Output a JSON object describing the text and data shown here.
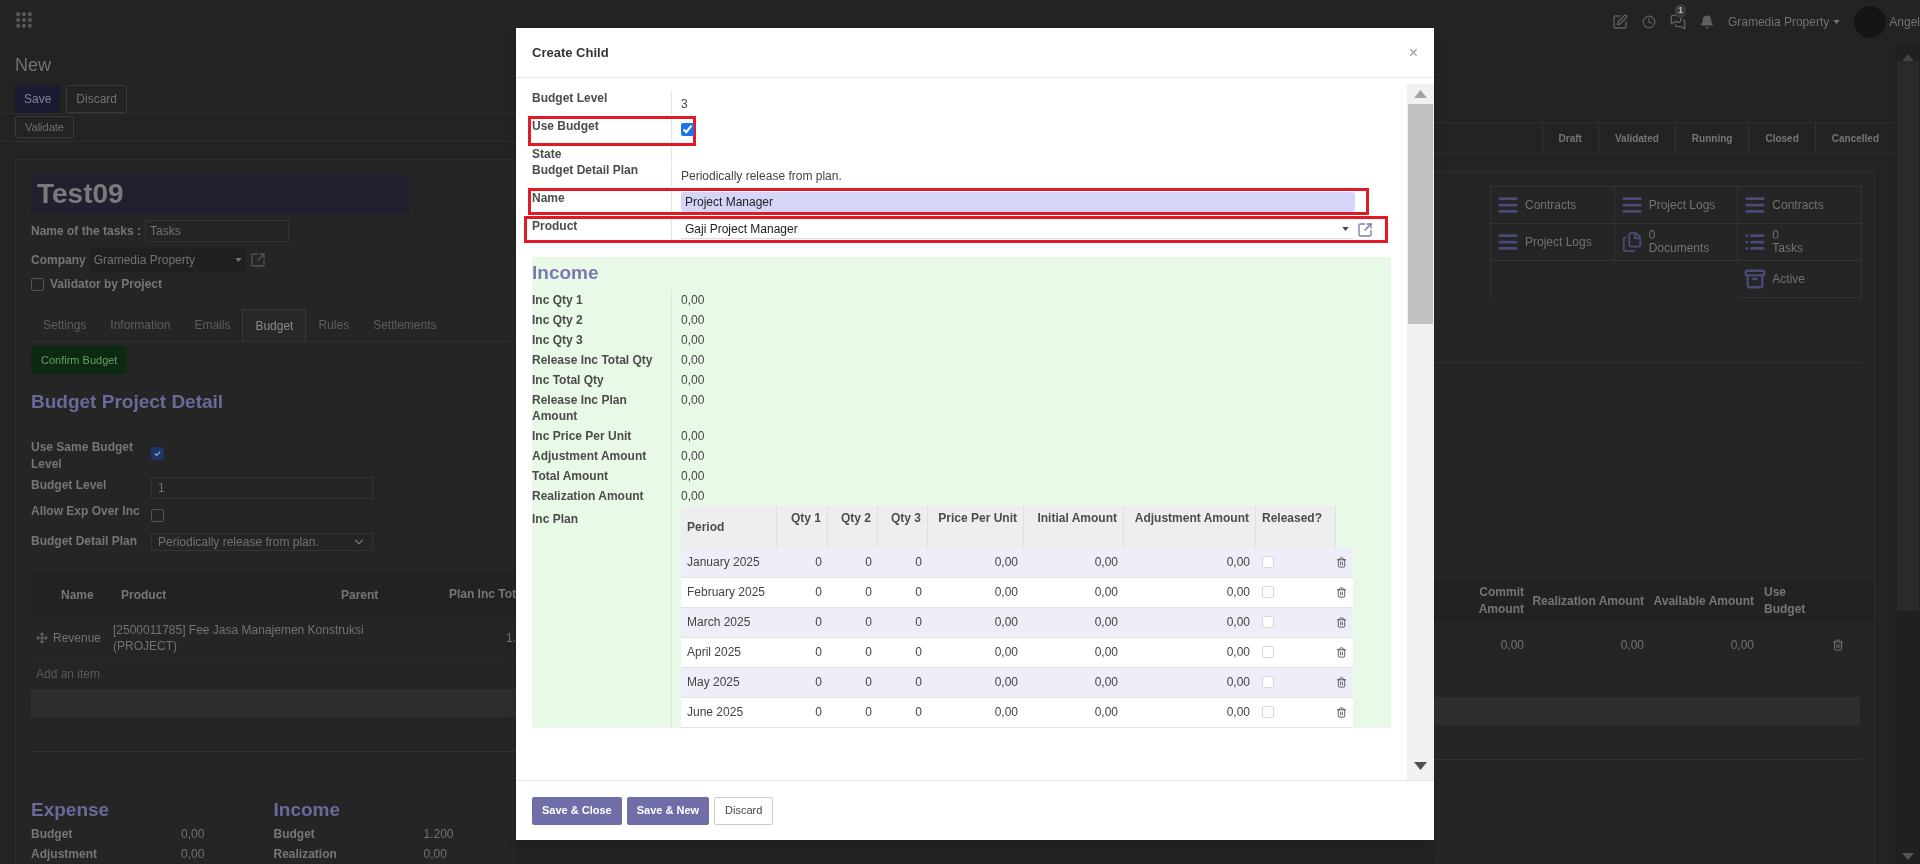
{
  "topbar": {
    "chat_badge": "1",
    "company": "Gramedia Property",
    "user": "Angel"
  },
  "breadcrumb": "New",
  "actions": [
    {
      "label": "Save",
      "kind": "primary"
    },
    {
      "label": "Discard",
      "kind": "secondary"
    }
  ],
  "status_action": "Validate",
  "stages": [
    {
      "label": "Draft",
      "selected": false
    },
    {
      "label": "Validated",
      "selected": false
    },
    {
      "label": "Running",
      "selected": false
    },
    {
      "label": "Closed",
      "selected": false
    },
    {
      "label": "Cancelled",
      "selected": false
    }
  ],
  "record": {
    "title": "Test09",
    "fields": [
      {
        "kind": "input",
        "label": "Name of the tasks :",
        "value": "Tasks"
      },
      {
        "kind": "select",
        "label": "Company",
        "value": "Gramedia Property"
      }
    ],
    "validator": {
      "label": "Validator by Project",
      "checked": false
    }
  },
  "smart_buttons": [
    {
      "kind": "list",
      "label": "Contracts"
    },
    {
      "kind": "list",
      "label": "Project Logs"
    },
    {
      "kind": "list",
      "label": "Contracts"
    },
    {
      "kind": "list",
      "label": "Project Logs"
    },
    {
      "kind": "documents",
      "count": "0",
      "label": "Documents"
    },
    {
      "kind": "tasks",
      "count": "0",
      "label": "Tasks"
    },
    {
      "kind": "archive",
      "label": "Active"
    }
  ],
  "tabs": [
    {
      "label": "Settings",
      "selected": false
    },
    {
      "label": "Information",
      "selected": false
    },
    {
      "label": "Emails",
      "selected": false
    },
    {
      "label": "Budget",
      "selected": true
    },
    {
      "label": "Rules",
      "selected": false
    },
    {
      "label": "Settlements",
      "selected": false
    }
  ],
  "confirm_button": "Confirm Budget",
  "section_title": "Budget Project Detail",
  "budget_fields": [
    {
      "kind": "checkbox",
      "label": "Use Same Budget Level",
      "checked": true
    },
    {
      "kind": "input",
      "label": "Budget Level",
      "value": "1"
    },
    {
      "kind": "checkbox",
      "label": "Allow Exp Over Inc",
      "checked": false
    },
    {
      "kind": "select",
      "label": "Budget Detail Plan",
      "value": "Periodically release from plan."
    }
  ],
  "budget_lines": {
    "columns_left": [
      "Name",
      "Product",
      "Parent",
      "Plan Inc Tot"
    ],
    "columns_right": [
      "Commit Amount",
      "Realization Amount",
      "Available Amount",
      "Use Budget"
    ],
    "row": {
      "name": "Revenue",
      "product": "[2500011785] Fee Jasa Manajemen Konstruksi (PROJECT)",
      "plan": "1.",
      "commit": "0,00",
      "realization": "0,00",
      "available": "0,00"
    },
    "add_item": "Add an item"
  },
  "summary": [
    {
      "title": "Expense",
      "rows": [
        {
          "label": "Budget",
          "value": "0,00"
        },
        {
          "label": "Adjustment",
          "value": "0,00"
        }
      ]
    },
    {
      "title": "Income",
      "rows": [
        {
          "label": "Budget",
          "value": "1.200"
        },
        {
          "label": "Realization",
          "value": "0,00"
        }
      ]
    }
  ],
  "dialog": {
    "title": "Create Child",
    "close": "×",
    "fields": [
      {
        "kind": "text",
        "label": "Budget Level",
        "value": "3",
        "highlighted": false
      },
      {
        "kind": "checkbox",
        "label": "Use Budget",
        "checked": true,
        "highlighted": true
      },
      {
        "kind": "text",
        "label": "State",
        "highlighted": false
      },
      {
        "kind": "text",
        "label": "Budget Detail Plan",
        "value": "Periodically release from plan.",
        "highlighted": false
      },
      {
        "kind": "input",
        "label": "Name",
        "value": "Project Manager",
        "highlighted": true
      },
      {
        "kind": "select",
        "label": "Product",
        "value": "Gaji Project Manager",
        "highlighted": true
      }
    ],
    "income": {
      "title": "Income",
      "fields": [
        {
          "label": "Inc Qty 1",
          "value": "0,00"
        },
        {
          "label": "Inc Qty 2",
          "value": "0,00"
        },
        {
          "label": "Inc Qty 3",
          "value": "0,00"
        },
        {
          "label": "Release Inc Total Qty",
          "value": "0,00"
        },
        {
          "label": "Inc Total Qty",
          "value": "0,00"
        },
        {
          "label": "Release Inc Plan Amount",
          "value": "0,00"
        },
        {
          "label": "Inc Price Per Unit",
          "value": "0,00"
        },
        {
          "label": "Adjustment Amount",
          "value": "0,00"
        },
        {
          "label": "Total Amount",
          "value": "0,00"
        },
        {
          "label": "Realization Amount",
          "value": "0,00"
        }
      ],
      "plan_label": "Inc Plan",
      "plan_columns": [
        "Period",
        "Qty 1",
        "Qty 2",
        "Qty 3",
        "Price Per Unit",
        "Initial Amount",
        "Adjustment Amount",
        "Released?"
      ],
      "plan_rows": [
        {
          "period": "January 2025",
          "qty1": "0",
          "qty2": "0",
          "qty3": "0",
          "price": "0,00",
          "initial": "0,00",
          "adjustment": "0,00",
          "released": false
        },
        {
          "period": "February 2025",
          "qty1": "0",
          "qty2": "0",
          "qty3": "0",
          "price": "0,00",
          "initial": "0,00",
          "adjustment": "0,00",
          "released": false
        },
        {
          "period": "March 2025",
          "qty1": "0",
          "qty2": "0",
          "qty3": "0",
          "price": "0,00",
          "initial": "0,00",
          "adjustment": "0,00",
          "released": false
        },
        {
          "period": "April 2025",
          "qty1": "0",
          "qty2": "0",
          "qty3": "0",
          "price": "0,00",
          "initial": "0,00",
          "adjustment": "0,00",
          "released": false
        },
        {
          "period": "May 2025",
          "qty1": "0",
          "qty2": "0",
          "qty3": "0",
          "price": "0,00",
          "initial": "0,00",
          "adjustment": "0,00",
          "released": false
        },
        {
          "period": "June 2025",
          "qty1": "0",
          "qty2": "0",
          "qty3": "0",
          "price": "0,00",
          "initial": "0,00",
          "adjustment": "0,00",
          "released": false
        }
      ]
    },
    "buttons": [
      {
        "label": "Save & Close",
        "kind": "primary"
      },
      {
        "label": "Save & New",
        "kind": "primary"
      },
      {
        "label": "Discard",
        "kind": "secondary"
      }
    ]
  }
}
